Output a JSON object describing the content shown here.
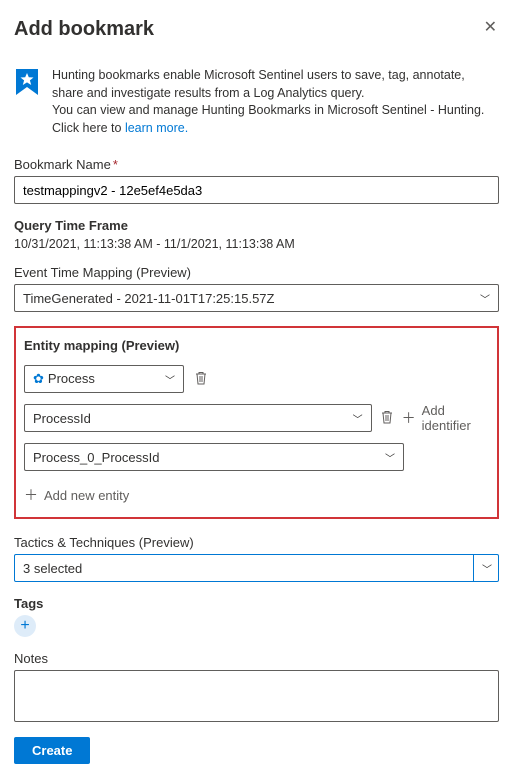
{
  "header": {
    "title": "Add bookmark"
  },
  "info": {
    "line1": "Hunting bookmarks enable Microsoft Sentinel users to save, tag, annotate, share and investigate results from a Log Analytics query.",
    "line2_prefix": "You can view and manage Hunting Bookmarks in Microsoft Sentinel - Hunting. Click here to ",
    "learn_more": "learn more."
  },
  "bookmark_name": {
    "label": "Bookmark Name",
    "value": "testmappingv2 - 12e5ef4e5da3"
  },
  "query_time": {
    "label": "Query Time Frame",
    "value": "10/31/2021, 11:13:38 AM - 11/1/2021, 11:13:38 AM"
  },
  "event_time": {
    "label": "Event Time Mapping (Preview)",
    "value": "TimeGenerated - 2021-11-01T17:25:15.57Z"
  },
  "entity": {
    "title": "Entity mapping (Preview)",
    "type_value": "Process",
    "identifier_value": "ProcessId",
    "column_value": "Process_0_ProcessId",
    "add_identifier_label": "Add identifier",
    "add_entity_label": "Add new entity"
  },
  "tactics": {
    "label": "Tactics & Techniques (Preview)",
    "value": "3 selected"
  },
  "tags": {
    "label": "Tags"
  },
  "notes": {
    "label": "Notes"
  },
  "footer": {
    "create_label": "Create"
  }
}
